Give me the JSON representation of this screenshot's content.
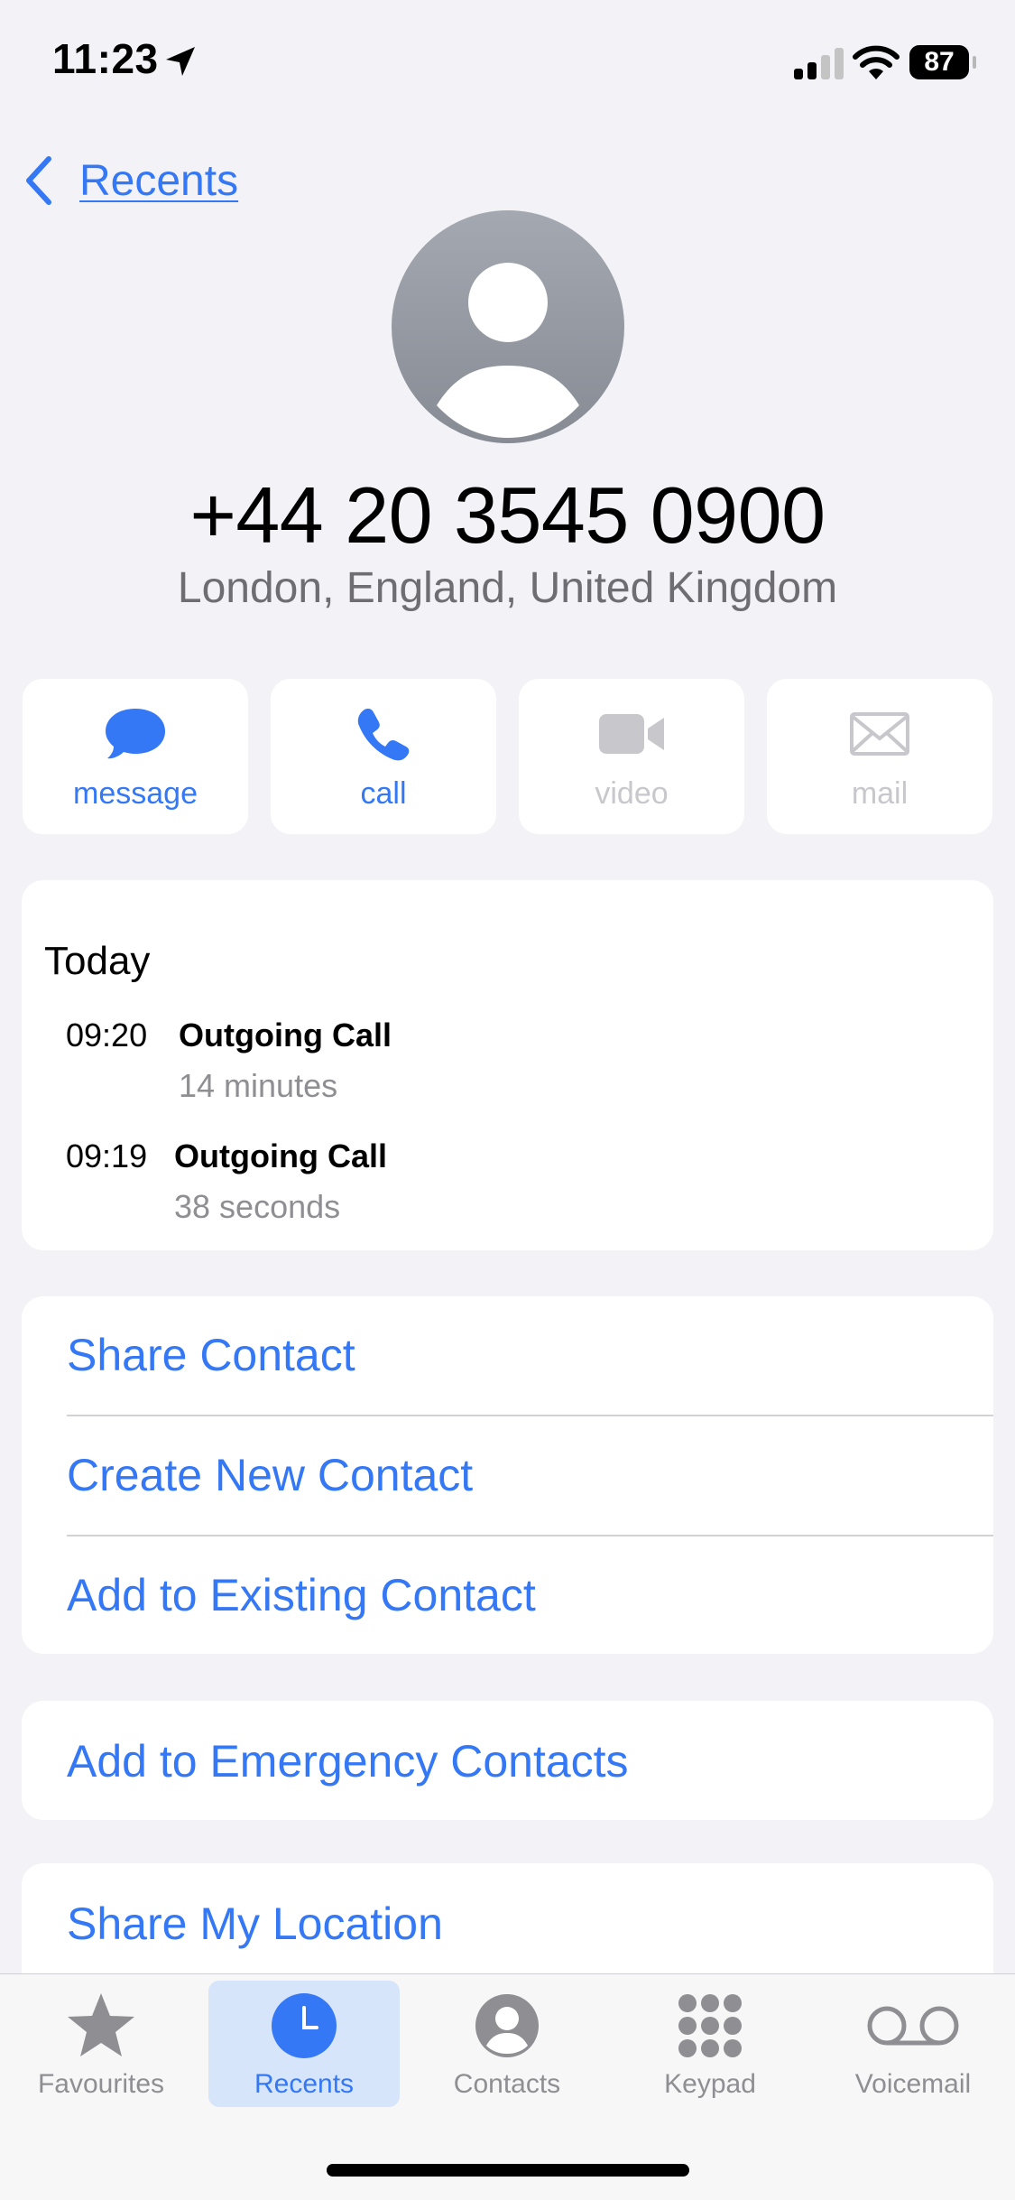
{
  "status_bar": {
    "time": "11:23",
    "battery": "87"
  },
  "nav": {
    "back_label": "Recents"
  },
  "contact": {
    "number": "+44 20 3545 0900",
    "location": "London, England, United Kingdom"
  },
  "actions": [
    {
      "label": "message",
      "enabled": true
    },
    {
      "label": "call",
      "enabled": true
    },
    {
      "label": "video",
      "enabled": false
    },
    {
      "label": "mail",
      "enabled": false
    }
  ],
  "history": {
    "day": "Today",
    "calls": [
      {
        "time": "09:20",
        "type": "Outgoing Call",
        "duration": "14 minutes"
      },
      {
        "time": "09:19",
        "type": "Outgoing Call",
        "duration": "38 seconds"
      }
    ]
  },
  "options": {
    "share_contact": "Share Contact",
    "create_new_contact": "Create New Contact",
    "add_to_existing": "Add to Existing Contact",
    "add_to_emergency": "Add to Emergency Contacts",
    "share_location": "Share My Location"
  },
  "tabs": [
    {
      "label": "Favourites",
      "icon": "star-icon",
      "active": false
    },
    {
      "label": "Recents",
      "icon": "clock-icon",
      "active": true
    },
    {
      "label": "Contacts",
      "icon": "person-circle-icon",
      "active": false
    },
    {
      "label": "Keypad",
      "icon": "keypad-icon",
      "active": false
    },
    {
      "label": "Voicemail",
      "icon": "voicemail-icon",
      "active": false
    }
  ],
  "colors": {
    "accent": "#3478f6",
    "background": "#f2f2f7",
    "disabled": "#c7c7cc",
    "secondary_text": "#6d6d72"
  }
}
